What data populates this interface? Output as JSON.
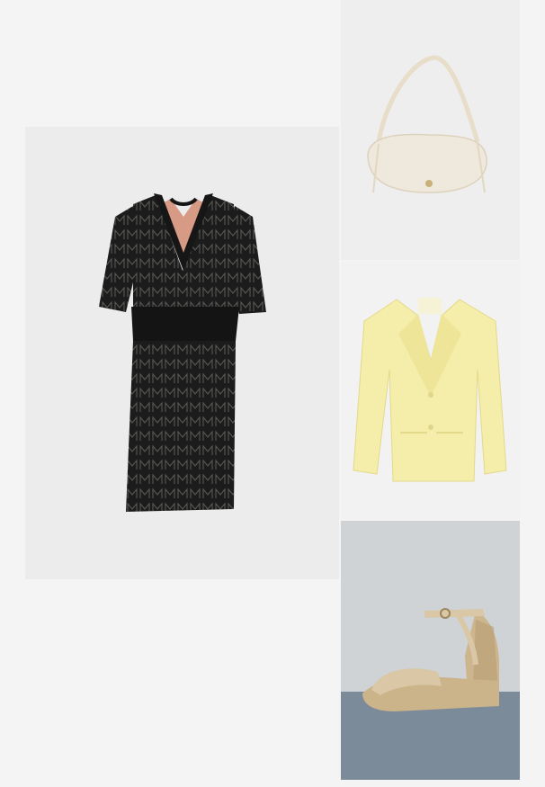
{
  "moodboard": {
    "items": [
      {
        "id": "dress",
        "product": "knit-dress",
        "icon": "dress-image"
      },
      {
        "id": "bag",
        "product": "shoulder-bag",
        "icon": "bag-image"
      },
      {
        "id": "blazer",
        "product": "blazer",
        "icon": "blazer-image"
      },
      {
        "id": "shoe",
        "product": "wedge-sandal",
        "icon": "sandal-image"
      }
    ]
  },
  "colors": {
    "page_background": "#f4f4f4",
    "dress": "#1c1c1c",
    "dress_skin": "#d79a84",
    "bag": "#efe8dc",
    "blazer": "#f5eeaa",
    "sandal": "#d9c7a5",
    "shoe_floor": "#7c8b99"
  }
}
